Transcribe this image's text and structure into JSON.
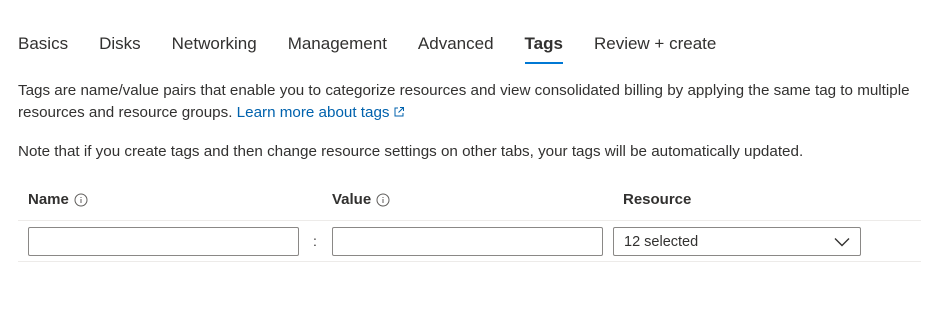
{
  "tabs": [
    {
      "label": "Basics"
    },
    {
      "label": "Disks"
    },
    {
      "label": "Networking"
    },
    {
      "label": "Management"
    },
    {
      "label": "Advanced"
    },
    {
      "label": "Tags",
      "active": true
    },
    {
      "label": "Review + create"
    }
  ],
  "description": {
    "text": "Tags are name/value pairs that enable you to categorize resources and view consolidated billing by applying the same tag to multiple resources and resource groups.",
    "link_label": "Learn more about tags"
  },
  "note": "Note that if you create tags and then change resource settings on other tabs, your tags will be automatically updated.",
  "table": {
    "columns": {
      "name": "Name",
      "value": "Value",
      "resource": "Resource"
    },
    "rows": [
      {
        "name": "",
        "value": "",
        "separator": ":",
        "resource": "12 selected"
      }
    ]
  },
  "colors": {
    "accent": "#0078d4",
    "link": "#0062ad",
    "text": "#323130",
    "border": "#8a8886"
  },
  "icons": [
    "info-icon",
    "external-link-icon",
    "chevron-down-icon"
  ]
}
